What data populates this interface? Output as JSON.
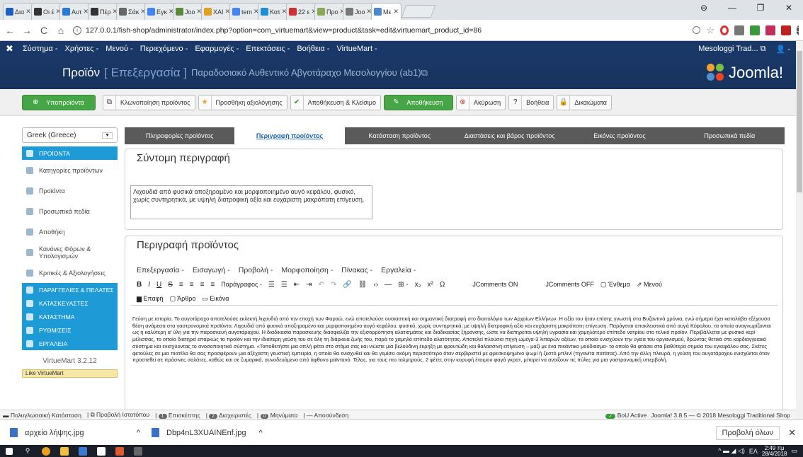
{
  "browser": {
    "tabs": [
      {
        "label": "Δια",
        "color": "#1f5fbf"
      },
      {
        "label": "Οι έ",
        "color": "#333"
      },
      {
        "label": "Αυτ",
        "color": "#2a7ad1"
      },
      {
        "label": "Πέρ",
        "color": "#333"
      },
      {
        "label": "Σάκ",
        "color": "#666"
      },
      {
        "label": "Εγκ",
        "color": "#4285f4"
      },
      {
        "label": "Joo",
        "color": "#5a8a3a"
      },
      {
        "label": "XAI",
        "color": "#e0a020"
      },
      {
        "label": "tem",
        "color": "#4285f4"
      },
      {
        "label": "Κατ",
        "color": "#1e8fd6"
      },
      {
        "label": "22 ε",
        "color": "#d03030"
      },
      {
        "label": "Προ",
        "color": "#8a5"
      },
      {
        "label": "Joo",
        "color": "#777"
      },
      {
        "label": "Με",
        "color": "#4a8acb"
      }
    ],
    "url": "127.0.0.1/fish-shop/administrator/index.php?option=com_virtuemart&view=product&task=edit&virtuemart_product_id=86",
    "back": "←",
    "forward": "→",
    "reload": "C",
    "home": "⌂",
    "profile": "⊖",
    "minimize": "—",
    "maximize": "❐",
    "close": "✕"
  },
  "jmenu": {
    "items": [
      "Σύστημα -",
      "Χρήστες -",
      "Μενού -",
      "Περιεχόμενο -",
      "Εφαρμογές -",
      "Επεκτάσεις -",
      "Βοήθεια -",
      "VirtueMart -"
    ],
    "site": "Mesologgi Trad... ⧉",
    "user": "👤 -"
  },
  "title": {
    "main": "Προϊόν",
    "mode": "[ Επεξεργασία ]",
    "name": "Παραδοσιακό Αυθεντικό Αβγοτάραχο Μεσολογγίου (ab1)⧉",
    "brand": "Joomla!"
  },
  "toolbar": {
    "child": "Υποπροϊόντα",
    "clone": "Κλωνοποίηση προϊόντος",
    "review": "Προσθήκη αξιολόγησης",
    "saveclose": "Αποθήκευση & Κλείσιμο",
    "save": "Αποθήκευση",
    "cancel": "Ακύρωση",
    "help": "Βοήθεια",
    "perms": "Δικαιώματα"
  },
  "sidebar": {
    "language": "Greek (Greece)",
    "items": [
      {
        "label": "ΠΡΟΪΟΝΤΑ",
        "blue": true
      },
      {
        "label": "Κατηγορίες προϊόντων"
      },
      {
        "label": "Προϊόντα"
      },
      {
        "label": "Προσωπικά πεδία"
      },
      {
        "label": "Αποθήκη"
      },
      {
        "label": "Κανόνες Φόρων & Υπολογισμών"
      },
      {
        "label": "Κριτικές & Αξιολογήσεις"
      },
      {
        "label": "ΠΑΡΑΓΓΕΛΙΕΣ & ΠΕΛΑΤΕΣ",
        "blue": true
      },
      {
        "label": "ΚΑΤΑΣΚΕΥΑΣΤΕΣ",
        "blue": true
      },
      {
        "label": "ΚΑΤΑΣΤΗΜΑ",
        "blue": true
      },
      {
        "label": "ΡΥΘΜΙΣΕΙΣ",
        "blue": true
      },
      {
        "label": "ΕΡΓΑΛΕΙΑ",
        "blue": true
      }
    ],
    "version": "VirtueMart 3.2.12",
    "like": "Like VirtueMart"
  },
  "tabs": [
    "Πληροφορίες προϊόντος",
    "Περιγραφή προϊόντος",
    "Κατάσταση προϊόντος",
    "Διαστάσεις και βάρος προϊόντος",
    "Εικόνες προϊόντος",
    "Προσωπικά πεδία"
  ],
  "short_desc": {
    "heading": "Σύντομη περιγραφή",
    "text": "Λιχουδιά από φυσικά αποξηραμένο και μορφοποιημένο αυγό κεφάλου, φυσικό, χωρίς συντηρητικά, με υψηλή διατροφική αξία και ευχάριστη μακρόπατη επίγευση."
  },
  "desc": {
    "heading": "Περιγραφή προϊόντος",
    "menu": [
      "Επεξεργασία -",
      "Εισαγωγή -",
      "Προβολή -",
      "Μορφοποίηση -",
      "Πίνακας -",
      "Εργαλεία -"
    ],
    "paragraph_select": "Παράγραφος -",
    "jcomments_on": "JComments ON",
    "jcomments_off": "JComments OFF",
    "insert": "Ένθεμα",
    "menu_btn": "Μενού",
    "article": "Επαφή",
    "article2": "Άρθρο",
    "image": "Εικόνα",
    "body": "Γεύση με ιστορία. Το αυγοτάραχο αποτελούσε εκλεκτή λιχουδιά από την εποχή των Φαραώ, ενώ αποτελούσε ουσιαστική και σημαντική διατροφή στο διαιτολόγιο των Αρχαίων Ελλήνων. Η αξία του ήταν επίσης γνωστή στα Βυζαντινά χρόνια, ενώ σήμερα έχει καταλάβει εξέχουσα θέση ανάμεσα στα γαστρονομικά προϊόντα. Λιχουδιά από φυσικά αποξηραμένο και μορφοποιημένο αυγό κεφάλου, φυσικό, χωρίς συντηρητικά, με υψηλή διατροφική αξία και ευχάριστη μακρόπατη επίγευση. Παράγεται αποκλειστικά από αυγά Κέφαλου, τα οποία αναγνωρίζονται ως η καλύτερη α' ύλη για την παρασκευή αυγοτάραχου. Η διαδικασία παρασκευής διασφαλίζει την εξισορρόπηση αλατισμάτος και διαδικασίας ξήρανσης, ώστε να διατηρείται υψηλή υγρασία και χαμηλότερο επίπεδο νατρίου στο τελικό προϊόν. Περιβάλλεται με φυσικό κερί μέλισσας, το οποίο διατηρεί επαρκώς το προϊόν και την ιδιαίτερη γεύση του σε όλη τη διάρκεια ζωής του, παρά το χαμηλό επίπεδο αλατότητας. Αποτελεί πλούσια πηγή ωμέγα-3 λιπαρών οξέων, τα οποία ενισχύουν την υγεία του οργανισμού, δρώντας θετικά στο καρδιαγγειακό σύστημα και ενισχύοντας το ανοσοποιητικό σύστημα. «Τοποθετήστε μια απλή φέτα στο στόμα σας και νιώστε μια βελούδινη έκρηξη με φρουτώδη και θαλασσινή επίγευση – μαζί με ένα πικάντικο μούδιασμα- το οποίο θα φτάσει στα βαθύτερα σημεία του εγκεφάλου σας. Σκέτες φετούλες σε μια πιατέλα θα σας προσφέρουν μια αξέχαστη γευστική εμπειρία, η οποία θα ενισχυθεί και θα γεμίσει ακόμη περισσότερο όταν σερβιριστεί με φρεσκοψημένο ψωμί ή ζεστό μπλινί (τηγανίτα πατάτας). Από την άλλη πλευρά, η γεύση του αυγοτάραχου ενισχύεται όταν προστεθεί σε πράσινες σαλάτες, καθώς και σε ζυμαρικά, συνοδευόμενο από άφθονο μαϊντανό. Τέλος, για τους πιο τολμηρούς, 2 φέτες στην κορυφή έτοιμου φαγά γκρατ, μπορεί να ανοίξουν τις πύλες για μια γαστρονομική υπερβολή."
  },
  "status": {
    "multilang": "Πολυγλωσσική Κατάσταση",
    "view_site": "Προβολή Ιστοτόπου",
    "visitors_count": "1",
    "visitors": "Επισκέπτης",
    "admins_count": "2",
    "admins": "Διαχειριστές",
    "messages_count": "0",
    "messages": "Μηνύματα",
    "logout": "Αποσύνδεση",
    "bou": "BoU Active",
    "version": "Joomla! 3.8.5 — © 2018 Mesologgi Traditional Shop"
  },
  "downloads": {
    "items": [
      "αρχείο λήψης.jpg",
      "Dbp4nL3XUAINEnf.jpg"
    ],
    "show_all": "Προβολή όλων"
  },
  "taskbar": {
    "time": "2:49 πμ",
    "date": "28/4/2018",
    "lang": "ΕΛ"
  }
}
